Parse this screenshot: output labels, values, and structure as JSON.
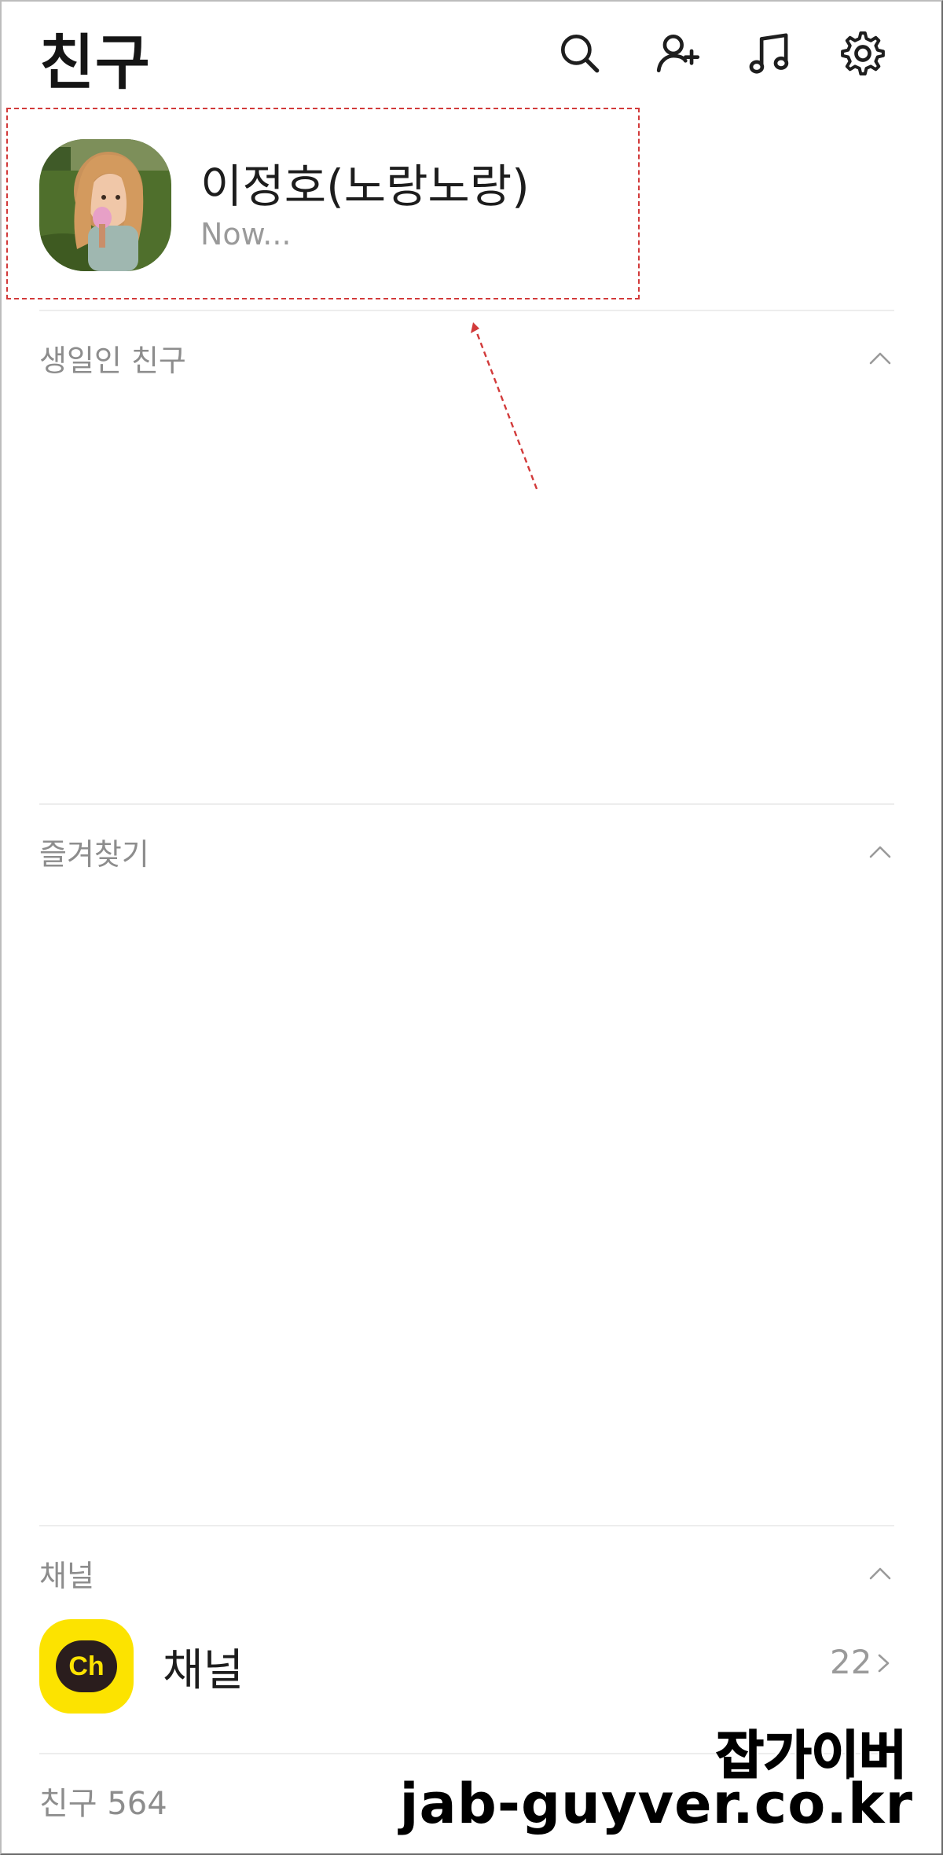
{
  "header": {
    "title": "친구",
    "icons": [
      "search-icon",
      "add-friend-icon",
      "music-icon",
      "settings-icon"
    ]
  },
  "profile": {
    "name": "이정호(노랑노랑)",
    "status": "Now..."
  },
  "sections": {
    "birthday": {
      "title": "생일인 친구"
    },
    "favorites": {
      "title": "즐겨찾기"
    },
    "channel": {
      "title": "채널"
    }
  },
  "channel_row": {
    "icon_text": "Ch",
    "name": "채널",
    "count": "22"
  },
  "friends": {
    "label": "친구 564"
  },
  "watermark": {
    "korean": "잡가이버",
    "url": "jab-guyver.co.kr"
  },
  "colors": {
    "highlight_border": "#d23a3a",
    "channel_yellow": "#fce300",
    "channel_bubble": "#2a1d1d",
    "muted_text": "#8d8d8d"
  }
}
